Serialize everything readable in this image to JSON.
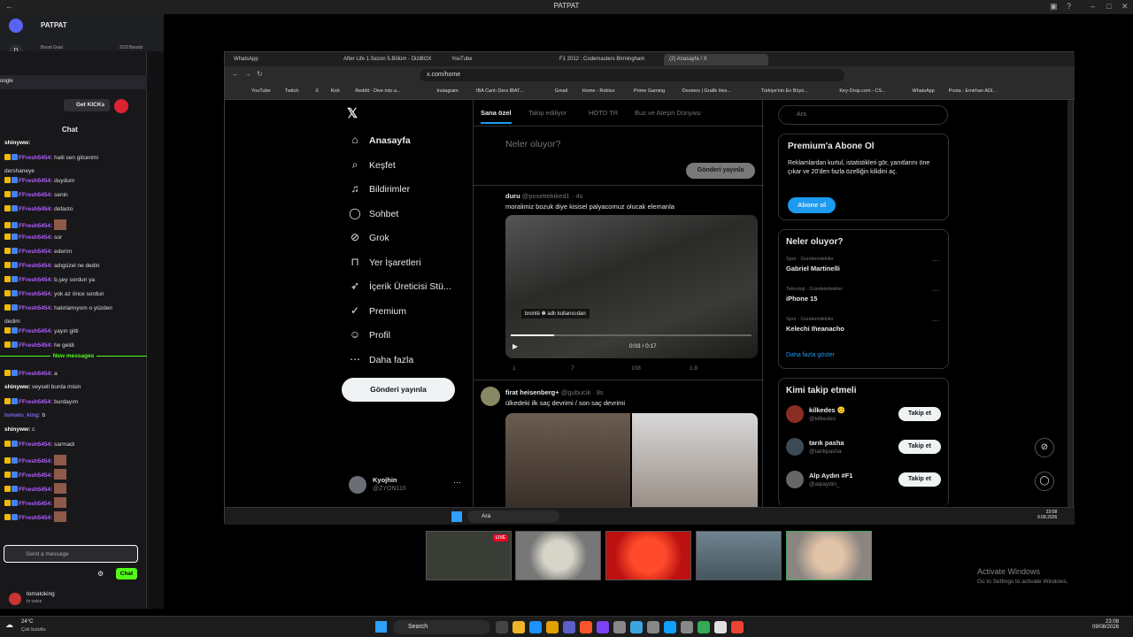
{
  "window_title": "PATPAT",
  "discord": {
    "server": "PATPAT",
    "boost_goal": "Boost Goal",
    "boost_count": "2/33 Boosts",
    "google_label": "oogle"
  },
  "chat": {
    "header": "Chat",
    "get_kicks": "Get KICKs",
    "lines": [
      {
        "user": "shinyww:",
        "text": "",
        "style": "u2"
      },
      {
        "user": "FFresh5454:",
        "text": "halil sen gitcenmi",
        "style": "u"
      },
      {
        "user": "",
        "text": "dershaneye",
        "style": "plain"
      },
      {
        "user": "FFresh5454:",
        "text": "duydum",
        "style": "u"
      },
      {
        "user": "FFresh5454:",
        "text": "senin",
        "style": "u"
      },
      {
        "user": "FFresh5454:",
        "text": "defacto",
        "style": "u"
      },
      {
        "user": "FFresh5454:",
        "text": "",
        "style": "u",
        "img": true
      },
      {
        "user": "FFresh5454:",
        "text": "sor",
        "style": "u"
      },
      {
        "user": "FFresh5454:",
        "text": "ederim",
        "style": "u"
      },
      {
        "user": "FFresh5454:",
        "text": "adıgüzel ne dedin",
        "style": "u"
      },
      {
        "user": "FFresh5454:",
        "text": "b,şey sordun ya",
        "style": "u"
      },
      {
        "user": "FFresh5454:",
        "text": "yok az önce sordun",
        "style": "u"
      },
      {
        "user": "FFresh5454:",
        "text": "hatırlamıyom o yüzden",
        "style": "u"
      },
      {
        "user": "",
        "text": "dedim",
        "style": "plain"
      },
      {
        "user": "FFresh5454:",
        "text": "yayın gitti",
        "style": "u"
      },
      {
        "user": "FFresh5454:",
        "text": "he geldi",
        "style": "u"
      }
    ],
    "new_messages": "New messages",
    "lines2": [
      {
        "user": "FFresh5454:",
        "text": "a",
        "style": "u"
      },
      {
        "user": "shinyww:",
        "text": "veysell burda misin",
        "style": "u2"
      },
      {
        "user": "FFresh5454:",
        "text": "burdayım",
        "style": "u"
      },
      {
        "user": "tomato_king:",
        "text": "b",
        "style": "u3"
      },
      {
        "user": "shinyww:",
        "text": "c",
        "style": "u2"
      },
      {
        "user": "FFresh5454:",
        "text": "sarmadı",
        "style": "u"
      },
      {
        "user": "FFresh5454:",
        "text": "",
        "style": "u",
        "img": true
      },
      {
        "user": "FFresh5454:",
        "text": "",
        "style": "u",
        "img": true
      },
      {
        "user": "FFresh5454:",
        "text": "",
        "style": "u",
        "img": true
      },
      {
        "user": "FFresh5454:",
        "text": "",
        "style": "u",
        "img": true
      },
      {
        "user": "FFresh5454:",
        "text": "",
        "style": "u",
        "img": true
      }
    ],
    "input_placeholder": "Send a message",
    "chat_button": "Chat",
    "voice_user": "tomatoking",
    "voice_status": "In voice"
  },
  "browser": {
    "tabs": [
      "WhatsApp",
      "After Life 1.Sezon 5.Bölüm - DiziBOX",
      "YouTube",
      "F1 2012 : Codemasters Birmingham",
      "(2) Anasayfa / X"
    ],
    "url": "x.com/home",
    "bookmarks": [
      "YouTube",
      "Twitch",
      "X",
      "Kick",
      "Reddit - Dive into a...",
      "Instagram",
      "IBA Canlı Ders IBAT...",
      "Gmail",
      "Home - Roblox",
      "Prime Gaming",
      "Desmos | Grafik Hes...",
      "Türkiye'nin En Büyü...",
      "Key-Drop.com - CS...",
      "WhatsApp",
      "Posta - Emirhan ADI..."
    ]
  },
  "x": {
    "nav": [
      {
        "icon": "⌂",
        "label": "Anasayfa",
        "bold": true
      },
      {
        "icon": "⌕",
        "label": "Keşfet"
      },
      {
        "icon": "♫",
        "label": "Bildirimler"
      },
      {
        "icon": "◯",
        "label": "Sohbet"
      },
      {
        "icon": "⊘",
        "label": "Grok"
      },
      {
        "icon": "⊓",
        "label": "Yer İşaretleri"
      },
      {
        "icon": "➶",
        "label": "İçerik Üreticisi Stü..."
      },
      {
        "icon": "✓",
        "label": "Premium"
      },
      {
        "icon": "☺",
        "label": "Profil"
      },
      {
        "icon": "⋯",
        "label": "Daha fazla"
      }
    ],
    "post_button": "Gönderi yayınla",
    "account_name": "Kyojhin",
    "account_handle": "@ZYON116",
    "feed_tabs": [
      "Sana özel",
      "Takip ediliyor",
      "HOTD TR",
      "Buz ve Ateşin Dünyası"
    ],
    "compose_placeholder": "Neler oluyor?",
    "compose_button": "Gönderi yayınla",
    "tweet1": {
      "name": "duru",
      "handle": "@posettekiked1 · 4s",
      "text": "moralimiz bozuk diye kisisel palyacomuz olucak elemanla",
      "caption": "brontë ✽ adlı kullanıcıdan",
      "time": "0:03 / 0:17",
      "replies": "1",
      "retweets": "7",
      "likes": "108",
      "views": "1.8"
    },
    "tweet2": {
      "name": "firat heisenberg+",
      "handle": "@gubucik · 8s",
      "text": "ülkedeki ilk saç devrimi / son saç devrimi"
    },
    "search": "Ara",
    "premium_title": "Premium'a Abone Ol",
    "premium_text": "Reklamlardan kurtul, istatistikleri gör, yanıtlarını öne çıkar ve 20'den fazla özelliğin kilidini aç.",
    "premium_button": "Abone ol",
    "trends_title": "Neler oluyor?",
    "trends": [
      {
        "cat": "Spor · Gündemdekiler",
        "name": "Gabriel Martinelli"
      },
      {
        "cat": "Teknoloji · Gündemdekiler",
        "name": "iPhone 15"
      },
      {
        "cat": "Spor · Gündemdekiler",
        "name": "Kelechi Iheanacho"
      }
    ],
    "show_more": "Daha fazla göster",
    "who_title": "Kimi takip etmeli",
    "who": [
      {
        "name": "kilkedes 😊",
        "handle": "@kilkedes",
        "btn": "Takip et"
      },
      {
        "name": "tarık pasha",
        "handle": "@tarikpasha",
        "btn": "Takip et"
      },
      {
        "name": "Alp Aydın #F1",
        "handle": "@alpaydin_",
        "btn": "Takip et"
      }
    ]
  },
  "inner_taskbar": {
    "search": "Ara",
    "time": "23:08",
    "date": "9.08.2026"
  },
  "live_badge": "LIVE",
  "activate": {
    "title": "Activate Windows",
    "sub": "Go to Settings to activate Windows."
  },
  "taskbar": {
    "weather": "24°C",
    "weather_sub": "Çok bulutlu",
    "search": "Search",
    "time": "23:08",
    "date": "09/08/2026"
  }
}
